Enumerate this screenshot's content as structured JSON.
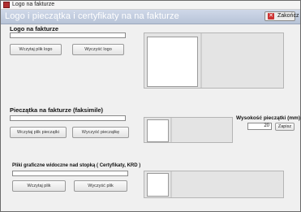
{
  "window": {
    "title": "Logo na fakturze"
  },
  "header": {
    "heading": "Logo i pieczątka i certyfikaty na na fakturze",
    "close_label": "Zakończ"
  },
  "logo_section": {
    "title": "Logo na fakturze",
    "field_value": "",
    "load_label": "Wczytaj plik logo",
    "clear_label": "Wyczyść logo"
  },
  "stamp_section": {
    "title": "Pieczątka na fakturze (faksimile)",
    "field_value": "",
    "load_label": "Wczytaj plik pieczątki",
    "clear_label": "Wyczyść pieczątkę",
    "height_label": "Wysokość pieczątki (mm)",
    "height_value": "20",
    "save_label": "Zapisz"
  },
  "files_section": {
    "title": "Pliki graficzne widoczne nad stopką ( Certyfikaty, KRD )",
    "field_value": "",
    "load_label": "Wczytaj plik",
    "clear_label": "Wyczyść plik"
  }
}
